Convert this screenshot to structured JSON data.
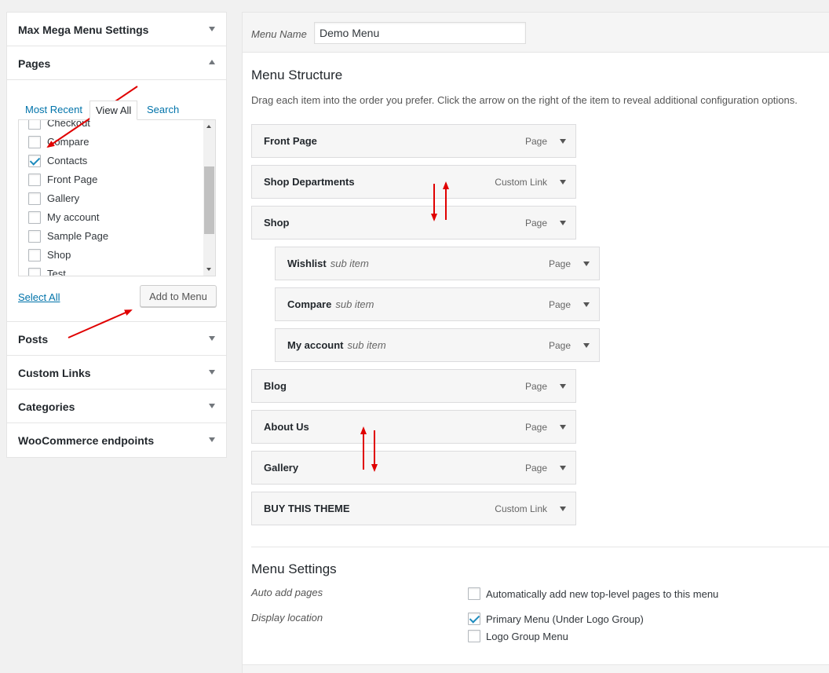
{
  "sidebar": {
    "sections": {
      "mega_menu": "Max Mega Menu Settings",
      "pages": "Pages",
      "posts": "Posts",
      "custom_links": "Custom Links",
      "categories": "Categories",
      "woo": "WooCommerce endpoints"
    },
    "tabs": {
      "recent": "Most Recent",
      "all": "View All",
      "search": "Search"
    },
    "pages_list": [
      {
        "label": "Checkout",
        "checked": false
      },
      {
        "label": "Compare",
        "checked": false
      },
      {
        "label": "Contacts",
        "checked": true
      },
      {
        "label": "Front Page",
        "checked": false
      },
      {
        "label": "Gallery",
        "checked": false
      },
      {
        "label": "My account",
        "checked": false
      },
      {
        "label": "Sample Page",
        "checked": false
      },
      {
        "label": "Shop",
        "checked": false
      },
      {
        "label": "Test",
        "checked": false
      }
    ],
    "select_all": "Select All",
    "add_to_menu": "Add to Menu"
  },
  "main": {
    "menu_name_label": "Menu Name",
    "menu_name_value": "Demo Menu",
    "structure_title": "Menu Structure",
    "structure_desc": "Drag each item into the order you prefer. Click the arrow on the right of the item to reveal additional configuration options.",
    "items": [
      {
        "title": "Front Page",
        "sub": "",
        "type": "Page",
        "depth": 0
      },
      {
        "title": "Shop Departments",
        "sub": "",
        "type": "Custom Link",
        "depth": 0
      },
      {
        "title": "Shop",
        "sub": "",
        "type": "Page",
        "depth": 0
      },
      {
        "title": "Wishlist",
        "sub": "sub item",
        "type": "Page",
        "depth": 1
      },
      {
        "title": "Compare",
        "sub": "sub item",
        "type": "Page",
        "depth": 1
      },
      {
        "title": "My account",
        "sub": "sub item",
        "type": "Page",
        "depth": 1
      },
      {
        "title": "Blog",
        "sub": "",
        "type": "Page",
        "depth": 0
      },
      {
        "title": "About Us",
        "sub": "",
        "type": "Page",
        "depth": 0
      },
      {
        "title": "Gallery",
        "sub": "",
        "type": "Page",
        "depth": 0
      },
      {
        "title": "BUY THIS THEME",
        "sub": "",
        "type": "Custom Link",
        "depth": 0
      }
    ],
    "settings": {
      "title": "Menu Settings",
      "auto_add_label": "Auto add pages",
      "auto_add_option": {
        "label": "Automatically add new top-level pages to this menu",
        "checked": false
      },
      "display_label": "Display location",
      "locations": [
        {
          "label": "Primary Menu (Under Logo Group)",
          "checked": true
        },
        {
          "label": "Logo Group Menu",
          "checked": false
        }
      ]
    }
  },
  "colors": {
    "link": "#0073aa",
    "annotation": "#e00000",
    "check": "#1e8cbe"
  }
}
